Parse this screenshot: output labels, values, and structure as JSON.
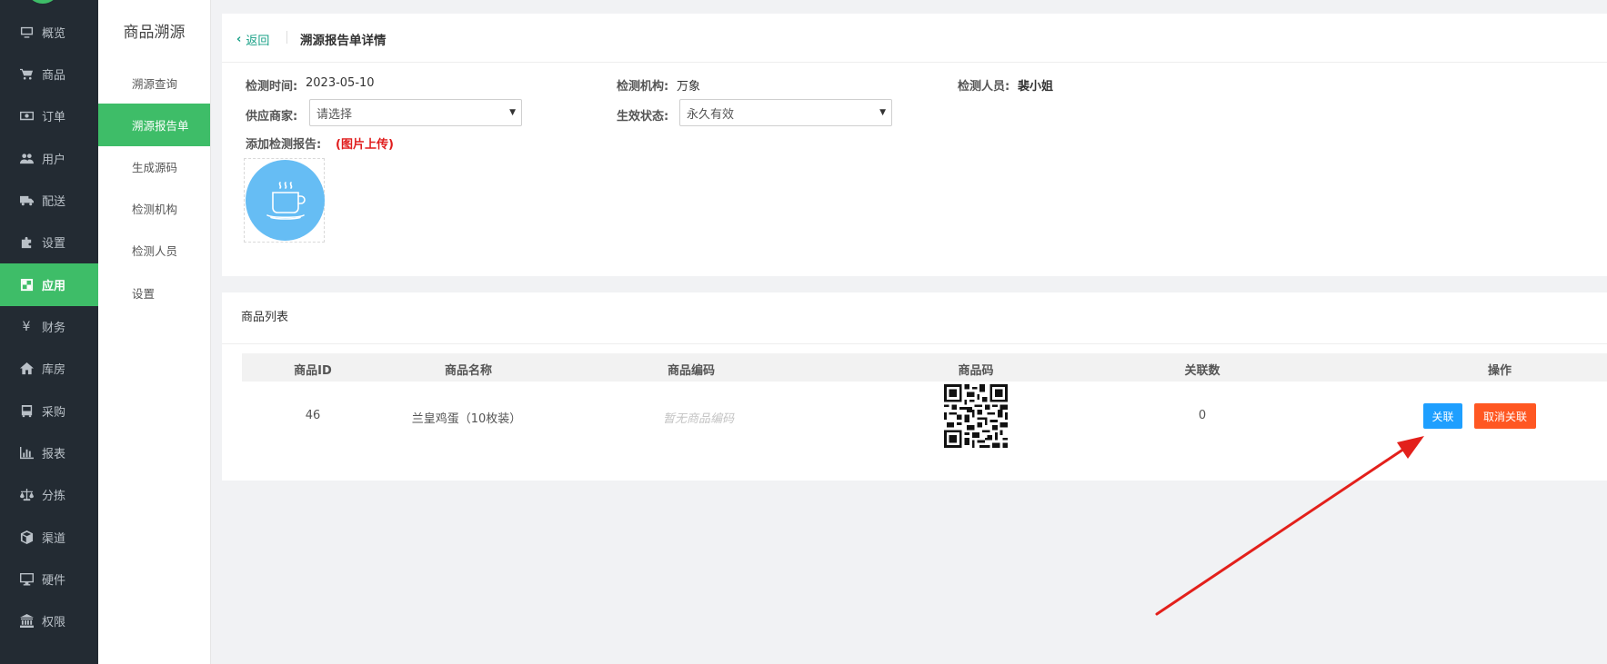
{
  "nav": {
    "items": [
      {
        "label": "概览",
        "icon": "monitor-icon"
      },
      {
        "label": "商品",
        "icon": "cart-icon"
      },
      {
        "label": "订单",
        "icon": "money-icon"
      },
      {
        "label": "用户",
        "icon": "users-icon"
      },
      {
        "label": "配送",
        "icon": "truck-icon"
      },
      {
        "label": "设置",
        "icon": "puzzle-icon"
      },
      {
        "label": "应用",
        "icon": "apps-icon",
        "active": true
      },
      {
        "label": "财务",
        "icon": "yen-icon"
      },
      {
        "label": "库房",
        "icon": "home-icon"
      },
      {
        "label": "采购",
        "icon": "bus-icon"
      },
      {
        "label": "报表",
        "icon": "bar-chart-icon"
      },
      {
        "label": "分拣",
        "icon": "scale-icon"
      },
      {
        "label": "渠道",
        "icon": "cube-icon"
      },
      {
        "label": "硬件",
        "icon": "desktop-icon"
      },
      {
        "label": "权限",
        "icon": "bank-icon"
      }
    ]
  },
  "submenu": {
    "title": "商品溯源",
    "items": [
      {
        "label": "溯源查询"
      },
      {
        "label": "溯源报告单",
        "active": true
      },
      {
        "label": "生成源码"
      },
      {
        "label": "检测机构"
      },
      {
        "label": "检测人员"
      },
      {
        "label": "设置"
      }
    ]
  },
  "detail": {
    "back_label": "返回",
    "title": "溯源报告单详情",
    "test_time_label": "检测时间:",
    "test_time_value": "2023-05-10",
    "test_org_label": "检测机构:",
    "test_org_value": "万象",
    "tester_label": "检测人员:",
    "tester_value": "裴小姐",
    "supplier_label": "供应商家:",
    "supplier_value": "请选择",
    "status_label": "生效状态:",
    "status_value": "永久有效",
    "add_report_label": "添加检测报告:",
    "upload_note": "(图片上传)"
  },
  "product_list": {
    "title": "商品列表",
    "columns": [
      "商品ID",
      "商品名称",
      "商品编码",
      "商品码",
      "关联数",
      "操作"
    ],
    "rows": [
      {
        "id": "46",
        "name": "兰皇鸡蛋（10枚装）",
        "code": "暂无商品编码",
        "link_count": "0"
      }
    ],
    "link_button": "关联",
    "unlink_button": "取消关联"
  },
  "colors": {
    "nav_bg": "#232b33",
    "accent_green": "#3ebd68",
    "link_blue": "#1e9fff",
    "unlink_orange": "#ff5722",
    "annotation_red": "#e3201b"
  }
}
